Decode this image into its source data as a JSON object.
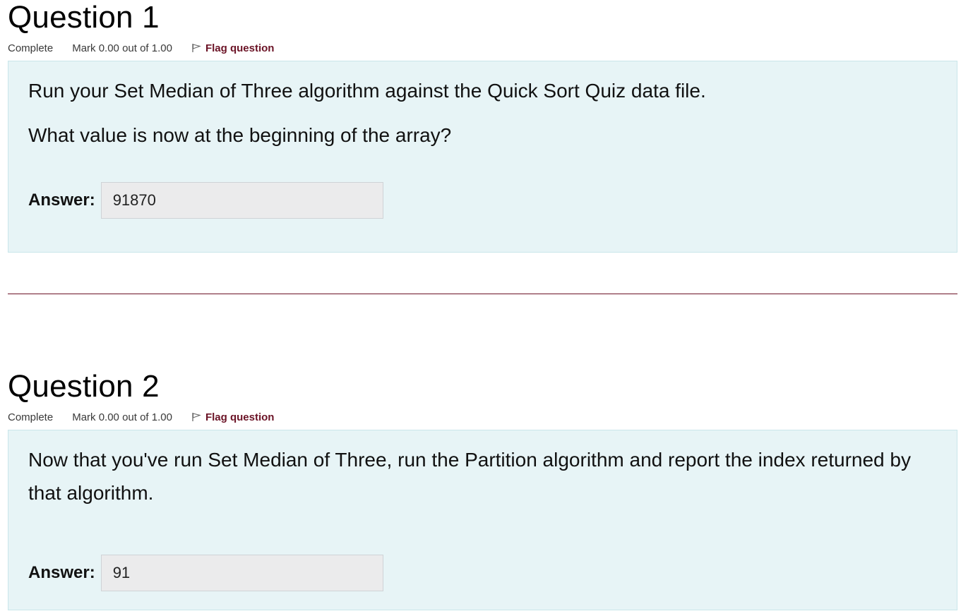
{
  "questions": [
    {
      "title": "Question 1",
      "state": "Complete",
      "mark": "Mark 0.00 out of 1.00",
      "flag_label": "Flag question",
      "text": [
        "Run your Set Median of Three algorithm against the Quick Sort Quiz data file.",
        "What value is now at the beginning of the array?"
      ],
      "answer_label": "Answer:",
      "answer_value": "91870"
    },
    {
      "title": "Question 2",
      "state": "Complete",
      "mark": "Mark 0.00 out of 1.00",
      "flag_label": "Flag question",
      "text": [
        "Now that you've run Set Median of Three, run the Partition algorithm and report the index returned by that algorithm."
      ],
      "answer_label": "Answer:",
      "answer_value": "91"
    }
  ],
  "colors": {
    "accent": "#6b1326",
    "formulation_bg": "#e7f4f6",
    "input_bg": "#ebebec"
  },
  "icons": {
    "flag": "flag-icon"
  }
}
